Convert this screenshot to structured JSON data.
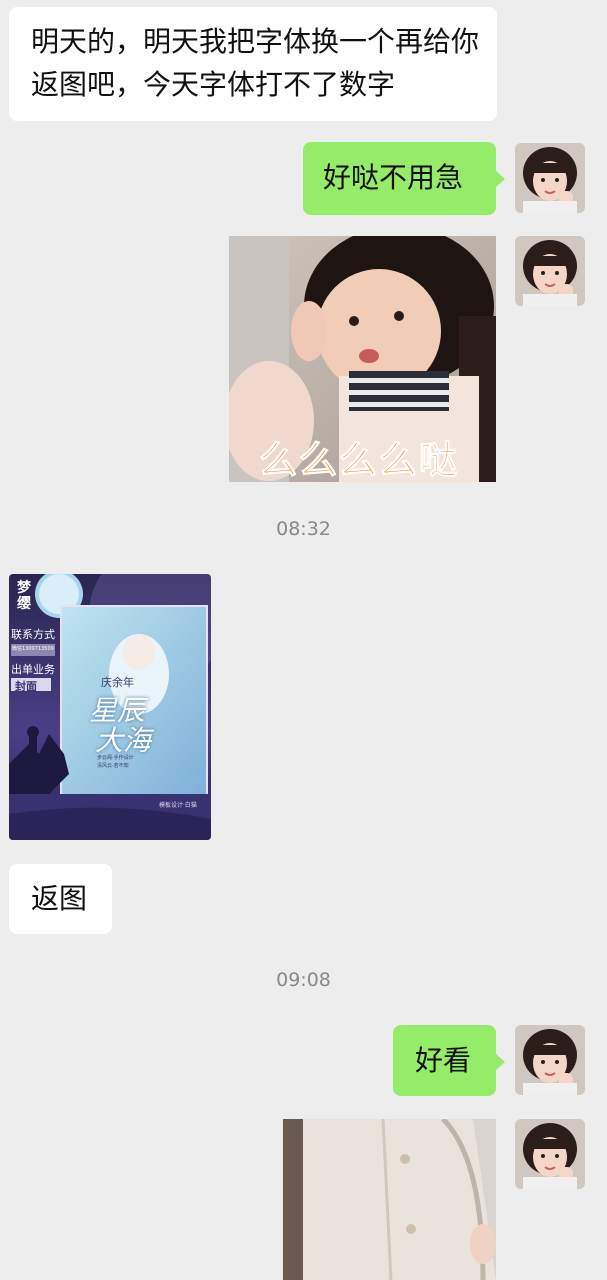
{
  "messages": {
    "m1": "明天的，明天我把字体换一个再给你返图吧，今天字体打不了数字",
    "m2": "好哒不用急",
    "sticker_caption": "么么么么哒",
    "time1": "08:32",
    "poster": {
      "studio": "梦缨",
      "contact_label": "联系方式",
      "contact_value": "微信1309713509",
      "business_label": "出单业务",
      "business_value": "封面",
      "book_small": "庆余年",
      "book_title_1": "星辰",
      "book_title_2": "大海",
      "tagline_1": "步云阁·手作设计",
      "tagline_2": "清风云·若不知",
      "credit": "模板设计·白猫"
    },
    "m3": "返图",
    "time2": "09:08",
    "m4": "好看"
  },
  "colors": {
    "background": "#ededed",
    "bubble_right": "#95ec69",
    "bubble_left": "#ffffff",
    "sticker_text": "#f08a1c"
  }
}
